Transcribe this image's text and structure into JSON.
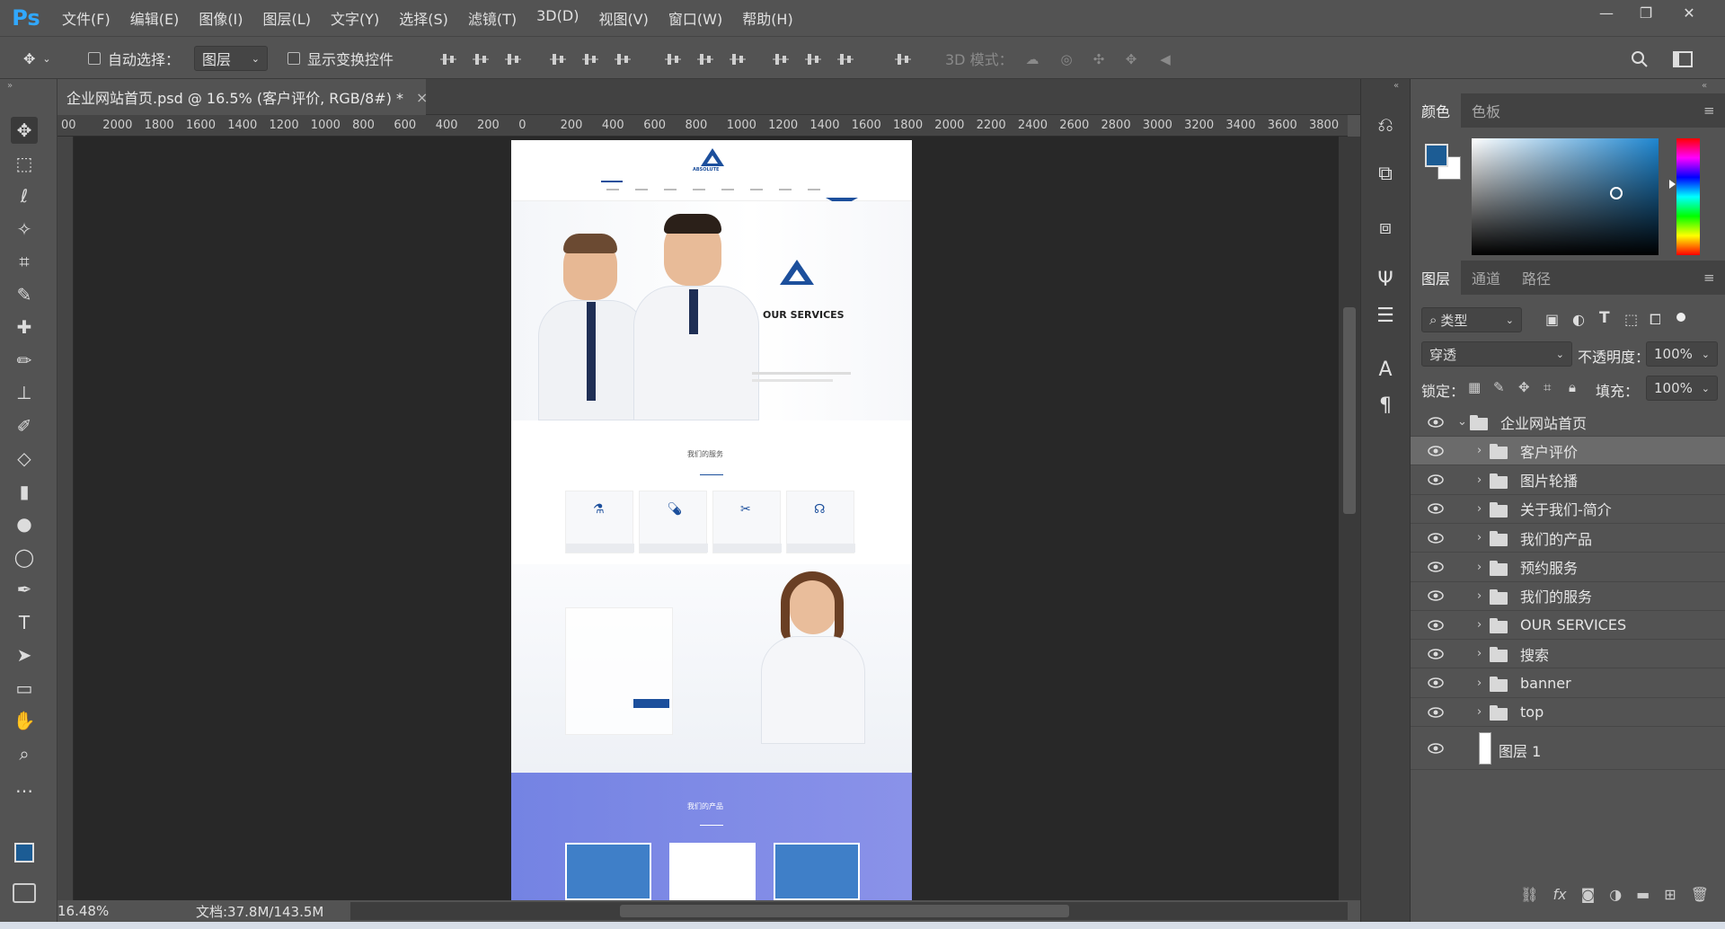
{
  "app": {
    "logo": "Ps"
  },
  "menu": [
    "文件(F)",
    "编辑(E)",
    "图像(I)",
    "图层(L)",
    "文字(Y)",
    "选择(S)",
    "滤镜(T)",
    "3D(D)",
    "视图(V)",
    "窗口(W)",
    "帮助(H)"
  ],
  "options": {
    "auto_select_label": "自动选择：",
    "auto_select_value": "图层",
    "show_transform_label": "显示变换控件",
    "mode_3d_label": "3D 模式："
  },
  "document": {
    "tab_title": "企业网站首页.psd @ 16.5% (客户评价, RGB/8#) *",
    "close": "×"
  },
  "ruler_h": [
    "00",
    "2000",
    "1800",
    "1600",
    "1400",
    "1200",
    "1000",
    "800",
    "600",
    "400",
    "200",
    "0",
    "200",
    "400",
    "600",
    "800",
    "1000",
    "1200",
    "1400",
    "1600",
    "1800",
    "2000",
    "2200",
    "2400",
    "2600",
    "2800",
    "3000",
    "3200",
    "3400",
    "3600",
    "3800"
  ],
  "status": {
    "zoom": "16.48%",
    "doc_size": "文档:37.8M/143.5M"
  },
  "site": {
    "logo_text": "ABSOLUTE",
    "hero_title": "OUR SERVICES",
    "services_title": "我们的服务",
    "products_title": "我们的产品"
  },
  "color_panel": {
    "tabs": [
      "颜色",
      "色板"
    ],
    "fg": "#1c5c94",
    "bg": "#ffffff"
  },
  "layers_panel": {
    "tabs": [
      "图层",
      "通道",
      "路径"
    ],
    "filter_label": "类型",
    "blend_mode": "穿透",
    "opacity_label": "不透明度：",
    "opacity_value": "100%",
    "lock_label": "锁定：",
    "fill_label": "填充：",
    "fill_value": "100%",
    "root_group": "企业网站首页",
    "groups": [
      "客户评价",
      "图片轮播",
      "关于我们-简介",
      "我们的产品",
      "预约服务",
      "我们的服务",
      "OUR SERVICES",
      "搜索",
      "banner",
      "top"
    ],
    "layer": "图层 1"
  }
}
